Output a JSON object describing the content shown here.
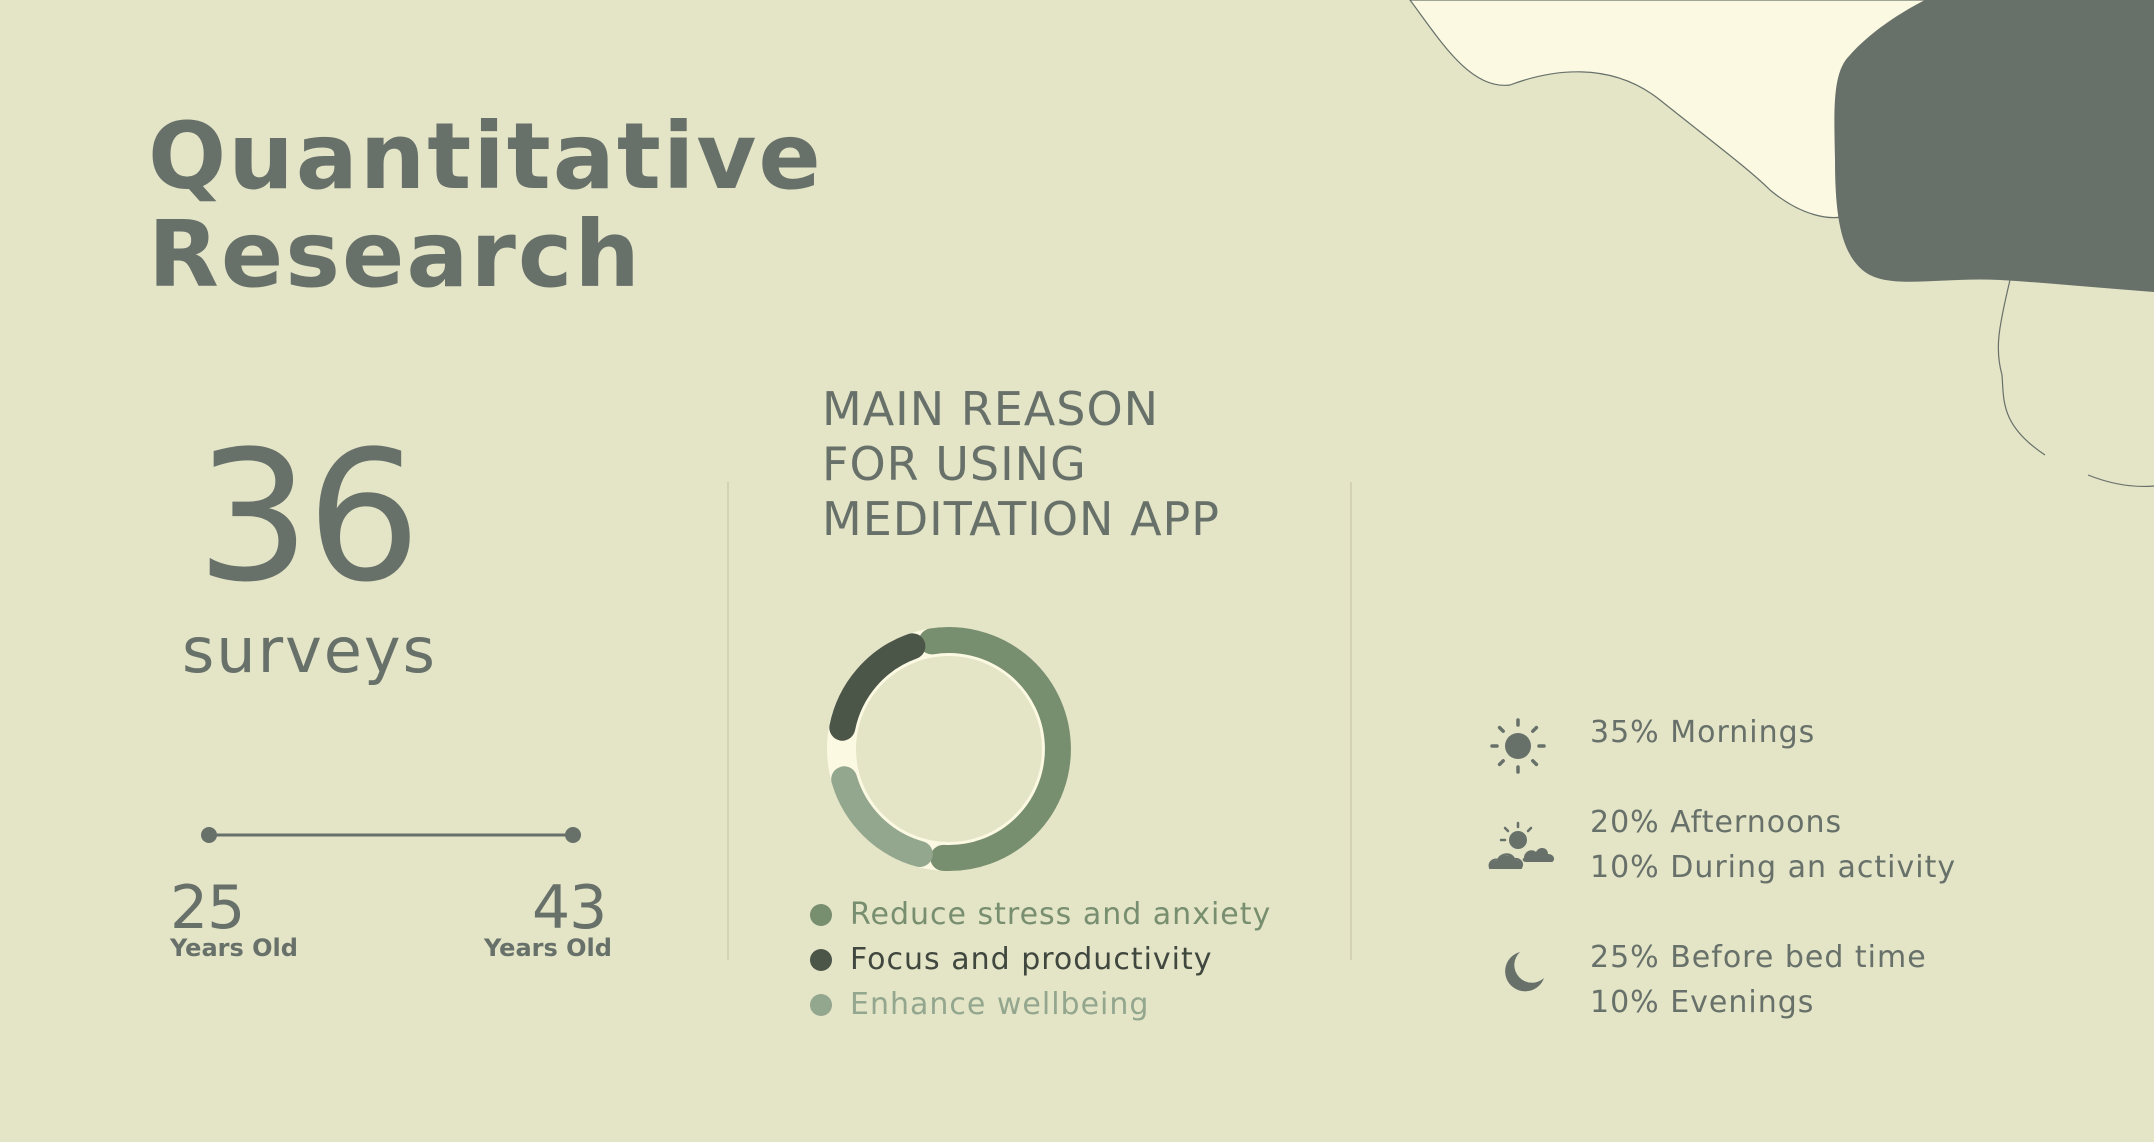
{
  "title": {
    "line1": "Quantitative",
    "line2": "Research"
  },
  "surveys": {
    "count": "36",
    "label": "surveys"
  },
  "age_range": {
    "min": {
      "value": "25",
      "label": "Years Old"
    },
    "max": {
      "value": "43",
      "label": "Years Old"
    }
  },
  "reason": {
    "title_lines": [
      "MAIN REASON",
      "FOR USING",
      "MEDITATION APP"
    ],
    "legend": [
      {
        "label": "Reduce stress and anxiety",
        "color": "#778e6f"
      },
      {
        "label": "Focus and productivity",
        "color": "#4b5649"
      },
      {
        "label": "Enhance wellbeing",
        "color": "#93a68e"
      }
    ]
  },
  "usage_times": [
    {
      "icon": "sun-icon",
      "lines": [
        "35% Mornings"
      ]
    },
    {
      "icon": "sun-cloud-icon",
      "lines": [
        "20% Afternoons",
        "10% During an activity"
      ]
    },
    {
      "icon": "moon-icon",
      "lines": [
        "25% Before bed time",
        "10% Evenings"
      ]
    }
  ],
  "colors": {
    "background": "#e4e4c6",
    "text": "#67716a",
    "cream": "#fcf9e2",
    "dark_blob": "#67716a"
  }
}
